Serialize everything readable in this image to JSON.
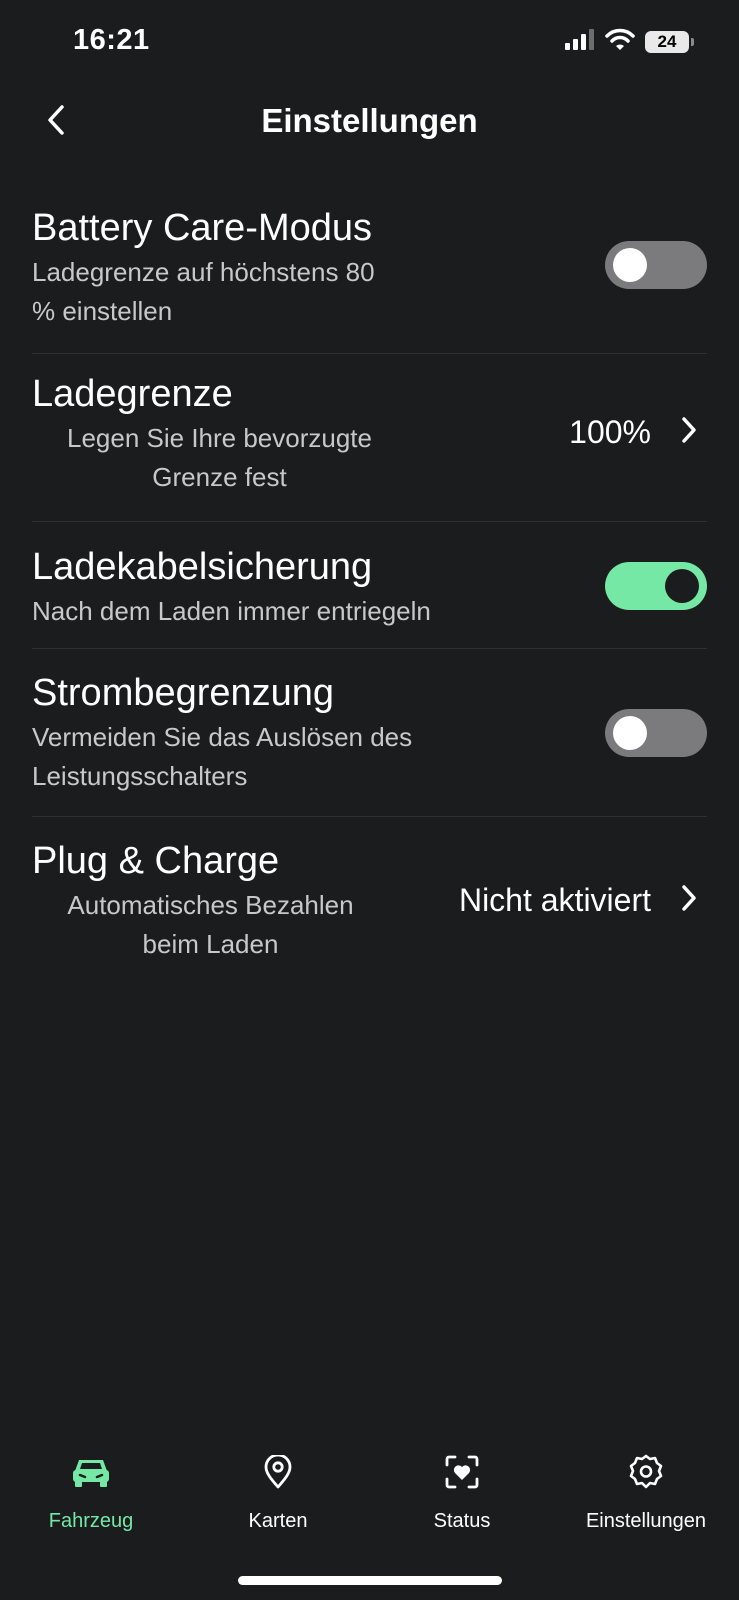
{
  "status_bar": {
    "time": "16:21",
    "battery": "24"
  },
  "header": {
    "title": "Einstellungen"
  },
  "settings": {
    "battery_care": {
      "title": "Battery Care-Modus",
      "line1": "Ladegrenze auf höchstens 80",
      "line2": "% einstellen",
      "enabled": false
    },
    "charge_limit": {
      "title": "Ladegrenze",
      "line1": "Legen Sie Ihre bevorzugte",
      "line2": "Grenze fest",
      "value": "100%"
    },
    "cable_lock": {
      "title": "Ladekabelsicherung",
      "line1": "Nach dem Laden immer entriegeln",
      "enabled": true
    },
    "current_limit": {
      "title": "Strombegrenzung",
      "line1": "Vermeiden Sie das Auslösen des",
      "line2": "Leistungsschalters",
      "enabled": false
    },
    "plug_charge": {
      "title": "Plug & Charge",
      "line1": "Automatisches Bezahlen",
      "line2": "beim Laden",
      "value": "Nicht aktiviert"
    }
  },
  "tabs": [
    {
      "label": "Fahrzeug",
      "icon": "car-icon",
      "active": true
    },
    {
      "label": "Karten",
      "icon": "map-pin-icon",
      "active": false
    },
    {
      "label": "Status",
      "icon": "heart-scan-icon",
      "active": false
    },
    {
      "label": "Einstellungen",
      "icon": "gear-icon",
      "active": false
    }
  ],
  "colors": {
    "background": "#1b1c1e",
    "accent": "#74e8a4",
    "toggle_off": "#7b7b7d",
    "subtext": "#c8c8c8",
    "divider": "#2f3033"
  }
}
